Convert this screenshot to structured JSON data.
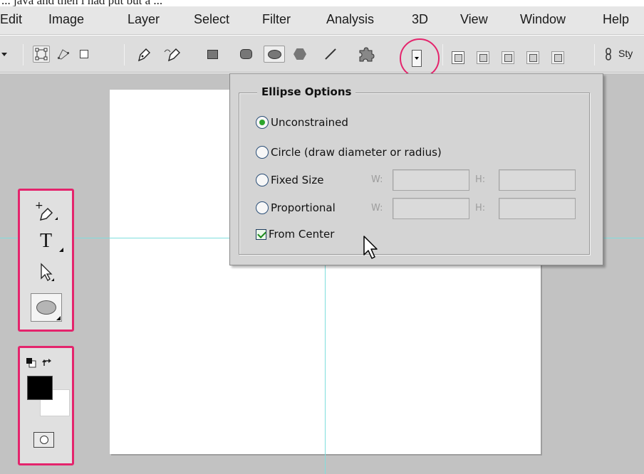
{
  "top_strip_text": "... java and then i had put but a ...",
  "menu": {
    "items": [
      "Edit",
      "Image",
      "Layer",
      "Select",
      "Filter",
      "Analysis",
      "3D",
      "View",
      "Window",
      "Help"
    ]
  },
  "options_bar": {
    "style_label": "Sty"
  },
  "ellipse_options": {
    "title": "Ellipse Options",
    "unconstrained": "Unconstrained",
    "circle": "Circle (draw diameter or radius)",
    "fixed_size": "Fixed Size",
    "proportional": "Proportional",
    "from_center": "From Center",
    "w_label": "W:",
    "h_label": "H:",
    "fixed_w_value": "",
    "fixed_h_value": "",
    "prop_w_value": "",
    "prop_h_value": "",
    "selected": "Unconstrained",
    "from_center_checked": true
  },
  "tools": {
    "type_tool_glyph": "T"
  },
  "colors": {
    "highlight": "#e4246c",
    "guide": "#7fdedd",
    "radio_checked": "#2ca52c"
  }
}
